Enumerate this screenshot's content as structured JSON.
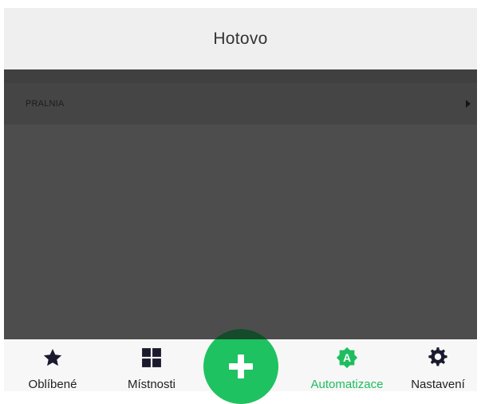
{
  "header": {
    "title": "Hotovo"
  },
  "list": {
    "rows": [
      {
        "label": "PRALNIA"
      }
    ]
  },
  "bottom_nav": {
    "items": [
      {
        "label": "Oblíbené",
        "icon": "star-icon"
      },
      {
        "label": "Místnosti",
        "icon": "grid-icon"
      },
      {
        "label": "Automatizace",
        "icon": "automation-badge-icon",
        "active": true
      },
      {
        "label": "Nastavení",
        "icon": "gear-icon"
      }
    ],
    "fab_icon": "plus-icon"
  },
  "colors": {
    "accent": "#1ebd5e",
    "header_bg": "#efefef",
    "overlay_bg": "#4d4d4d",
    "nav_bg": "#f7f7f7",
    "icon_dark": "#1a1a2e"
  }
}
